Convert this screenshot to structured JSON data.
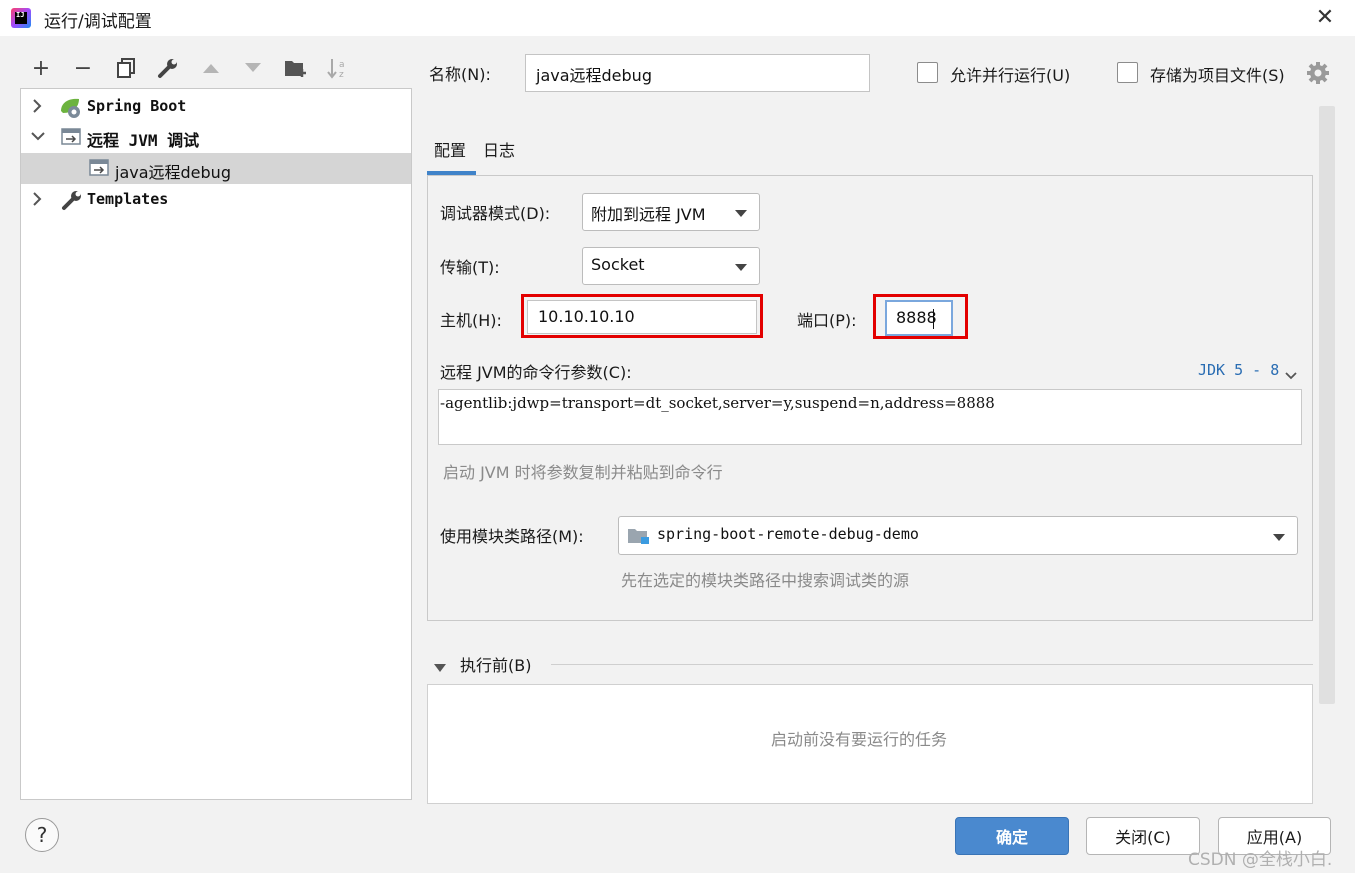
{
  "window": {
    "title": "运行/调试配置"
  },
  "tree": {
    "items": [
      {
        "label": "Spring Boot"
      },
      {
        "label": "远程 JVM 调试"
      },
      {
        "label": "java远程debug"
      },
      {
        "label": "Templates"
      }
    ]
  },
  "form": {
    "name_label": "名称(N):",
    "name_value": "java远程debug",
    "allow_parallel_label": "允许并行运行(U)",
    "store_as_file_label": "存储为项目文件(S)",
    "tabs": [
      "配置",
      "日志"
    ],
    "debugger_mode_label": "调试器模式(D):",
    "debugger_mode_value": "附加到远程 JVM",
    "transport_label": "传输(T):",
    "transport_value": "Socket",
    "host_label": "主机(H):",
    "host_value": "10.10.10.10",
    "port_label": "端口(P):",
    "port_value": "8888",
    "cmd_args_label": "远程 JVM的命令行参数(C):",
    "jdk_link": "JDK 5 - 8",
    "cmd_args_value": "-agentlib:jdwp=transport=dt_socket,server=y,suspend=n,address=8888",
    "cmd_args_hint": "启动 JVM 时将参数复制并粘贴到命令行",
    "module_label": "使用模块类路径(M):",
    "module_value": "spring-boot-remote-debug-demo",
    "module_hint": "先在选定的模块类路径中搜索调试类的源"
  },
  "before_launch": {
    "title": "执行前(B)",
    "empty_text": "启动前没有要运行的任务"
  },
  "footer": {
    "help": "?",
    "ok": "确定",
    "close": "关闭(C)",
    "apply": "应用(A)"
  },
  "watermark": "CSDN @全栈小白.",
  "colors": {
    "accent": "#4a89cf",
    "highlight": "#e30000",
    "link": "#2a6db3"
  }
}
